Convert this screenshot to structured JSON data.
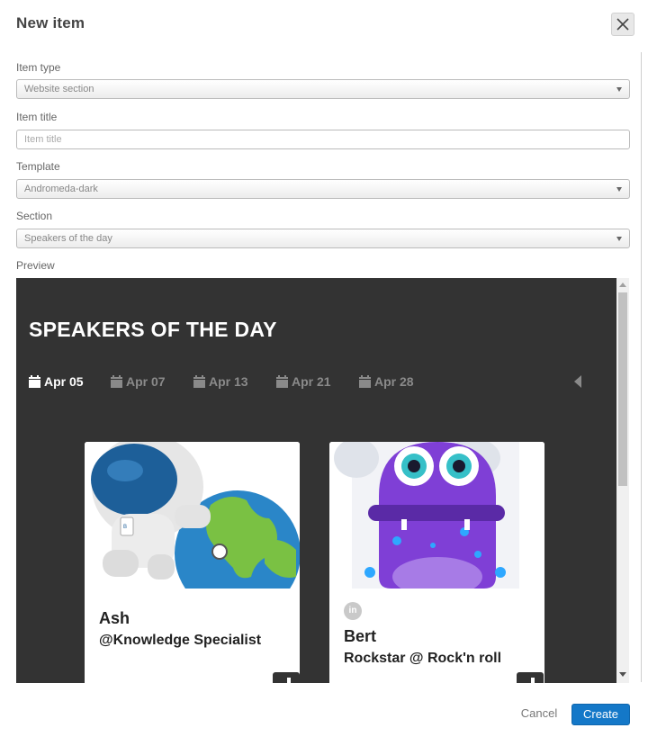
{
  "dialog": {
    "title": "New item",
    "close_icon": "close-icon"
  },
  "form": {
    "item_type": {
      "label": "Item type",
      "value": "Website section"
    },
    "item_title": {
      "label": "Item title",
      "placeholder": "Item title",
      "value": ""
    },
    "template": {
      "label": "Template",
      "value": "Andromeda-dark"
    },
    "section": {
      "label": "Section",
      "value": "Speakers of the day"
    },
    "preview_label": "Preview"
  },
  "preview": {
    "heading": "SPEAKERS OF THE DAY",
    "dates": [
      {
        "label": "Apr 05",
        "active": true
      },
      {
        "label": "Apr 07",
        "active": false
      },
      {
        "label": "Apr 13",
        "active": false
      },
      {
        "label": "Apr 21",
        "active": false
      },
      {
        "label": "Apr 28",
        "active": false
      }
    ],
    "speakers": [
      {
        "name": "Ash",
        "role": "@Knowledge Specialist",
        "image": "astronaut-illustration"
      },
      {
        "name": "Bert",
        "role": "Rockstar @ Rock'n roll",
        "image": "purple-monster-illustration",
        "social_icon": "linkedin-icon",
        "social_text": "in"
      }
    ]
  },
  "footer": {
    "cancel_label": "Cancel",
    "create_label": "Create"
  },
  "colors": {
    "accent": "#1478c8",
    "preview_bg": "#333333"
  }
}
